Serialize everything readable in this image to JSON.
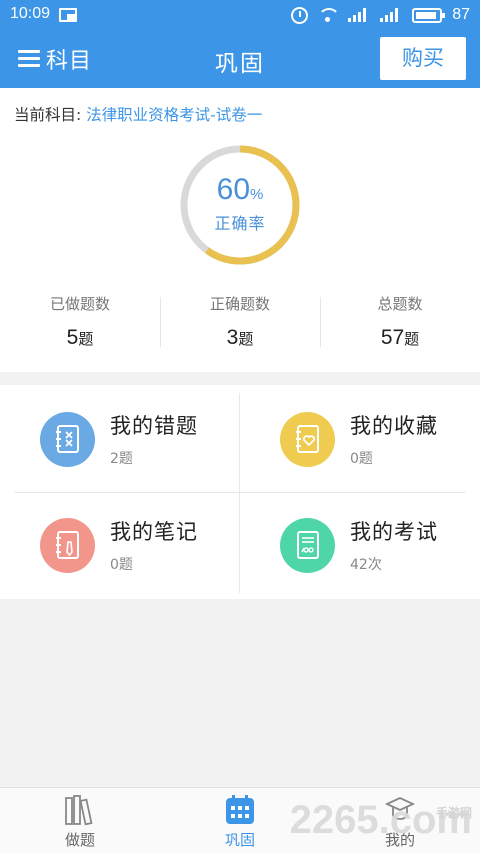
{
  "status_bar": {
    "time": "10:09",
    "battery": "87"
  },
  "header": {
    "menu_label": "科目",
    "title": "巩固",
    "buy_label": "购买"
  },
  "subject": {
    "label": "当前科目:",
    "value": "法律职业资格考试-试卷一"
  },
  "accuracy": {
    "value": "60",
    "unit": "%",
    "label": "正确率",
    "ratio": 0.6
  },
  "counts": [
    {
      "label": "已做题数",
      "value": "5",
      "unit": "题"
    },
    {
      "label": "正确题数",
      "value": "3",
      "unit": "题"
    },
    {
      "label": "总题数",
      "value": "57",
      "unit": "题"
    }
  ],
  "features": [
    {
      "name": "我的错题",
      "count": "2题",
      "color": "#6aa9e3"
    },
    {
      "name": "我的收藏",
      "count": "0题",
      "color": "#efcc4f"
    },
    {
      "name": "我的笔记",
      "count": "0题",
      "color": "#f2968c"
    },
    {
      "name": "我的考试",
      "count": "42次",
      "color": "#4fd6a8"
    }
  ],
  "bottom_nav": [
    {
      "label": "做题",
      "icon": "books-icon"
    },
    {
      "label": "巩固",
      "icon": "calendar-icon",
      "active": true
    },
    {
      "label": "我的",
      "icon": "profile-icon"
    }
  ],
  "watermark": {
    "text": "2265",
    "suffix": ".com",
    "sub": "手游网"
  },
  "colors": {
    "primary": "#3c95e6",
    "ring_fill": "#e8c150",
    "ring_track": "#d9d9d9"
  }
}
